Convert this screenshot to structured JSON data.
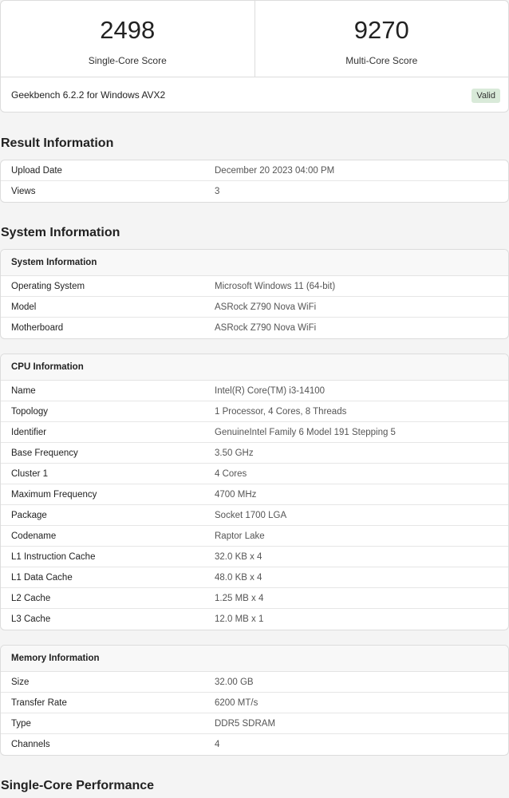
{
  "scores": {
    "single": {
      "value": "2498",
      "label": "Single-Core Score"
    },
    "multi": {
      "value": "9270",
      "label": "Multi-Core Score"
    },
    "version": "Geekbench 6.2.2 for Windows AVX2",
    "status": "Valid"
  },
  "result": {
    "title": "Result Information",
    "rows": [
      {
        "k": "Upload Date",
        "v": "December 20 2023 04:00 PM"
      },
      {
        "k": "Views",
        "v": "3"
      }
    ]
  },
  "system": {
    "title": "System Information",
    "header": "System Information",
    "rows": [
      {
        "k": "Operating System",
        "v": "Microsoft Windows 11 (64-bit)"
      },
      {
        "k": "Model",
        "v": "ASRock Z790 Nova WiFi"
      },
      {
        "k": "Motherboard",
        "v": "ASRock Z790 Nova WiFi"
      }
    ]
  },
  "cpu": {
    "header": "CPU Information",
    "rows": [
      {
        "k": "Name",
        "v": "Intel(R) Core(TM) i3-14100"
      },
      {
        "k": "Topology",
        "v": "1 Processor, 4 Cores, 8 Threads"
      },
      {
        "k": "Identifier",
        "v": "GenuineIntel Family 6 Model 191 Stepping 5"
      },
      {
        "k": "Base Frequency",
        "v": "3.50 GHz"
      },
      {
        "k": "Cluster 1",
        "v": "4 Cores"
      },
      {
        "k": "Maximum Frequency",
        "v": "4700 MHz"
      },
      {
        "k": "Package",
        "v": "Socket 1700 LGA"
      },
      {
        "k": "Codename",
        "v": "Raptor Lake"
      },
      {
        "k": "L1 Instruction Cache",
        "v": "32.0 KB x 4"
      },
      {
        "k": "L1 Data Cache",
        "v": "48.0 KB x 4"
      },
      {
        "k": "L2 Cache",
        "v": "1.25 MB x 4"
      },
      {
        "k": "L3 Cache",
        "v": "12.0 MB x 1"
      }
    ]
  },
  "memory": {
    "header": "Memory Information",
    "rows": [
      {
        "k": "Size",
        "v": "32.00 GB"
      },
      {
        "k": "Transfer Rate",
        "v": "6200 MT/s"
      },
      {
        "k": "Type",
        "v": "DDR5 SDRAM"
      },
      {
        "k": "Channels",
        "v": "4"
      }
    ]
  },
  "single_perf": {
    "title": "Single-Core Performance"
  }
}
